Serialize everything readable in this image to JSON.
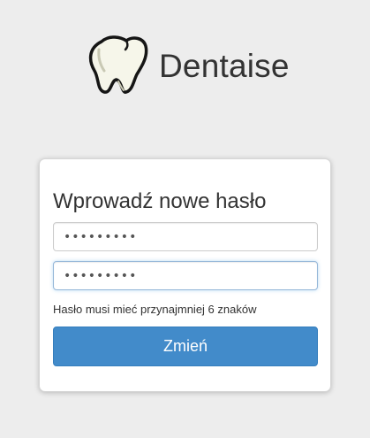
{
  "brand": {
    "name": "Dentaise",
    "logo_icon": "tooth-icon"
  },
  "form": {
    "title": "Wprowadź nowe hasło",
    "new_password_value": "•••••••••",
    "confirm_password_value": "•••••••••",
    "hint": "Hasło musi mieć przynajmniej 6 znaków",
    "submit_label": "Zmień"
  },
  "colors": {
    "background": "#ededed",
    "card": "#ffffff",
    "primary_button": "#428bca",
    "focus_border": "#96b8d9",
    "text": "#333333"
  }
}
